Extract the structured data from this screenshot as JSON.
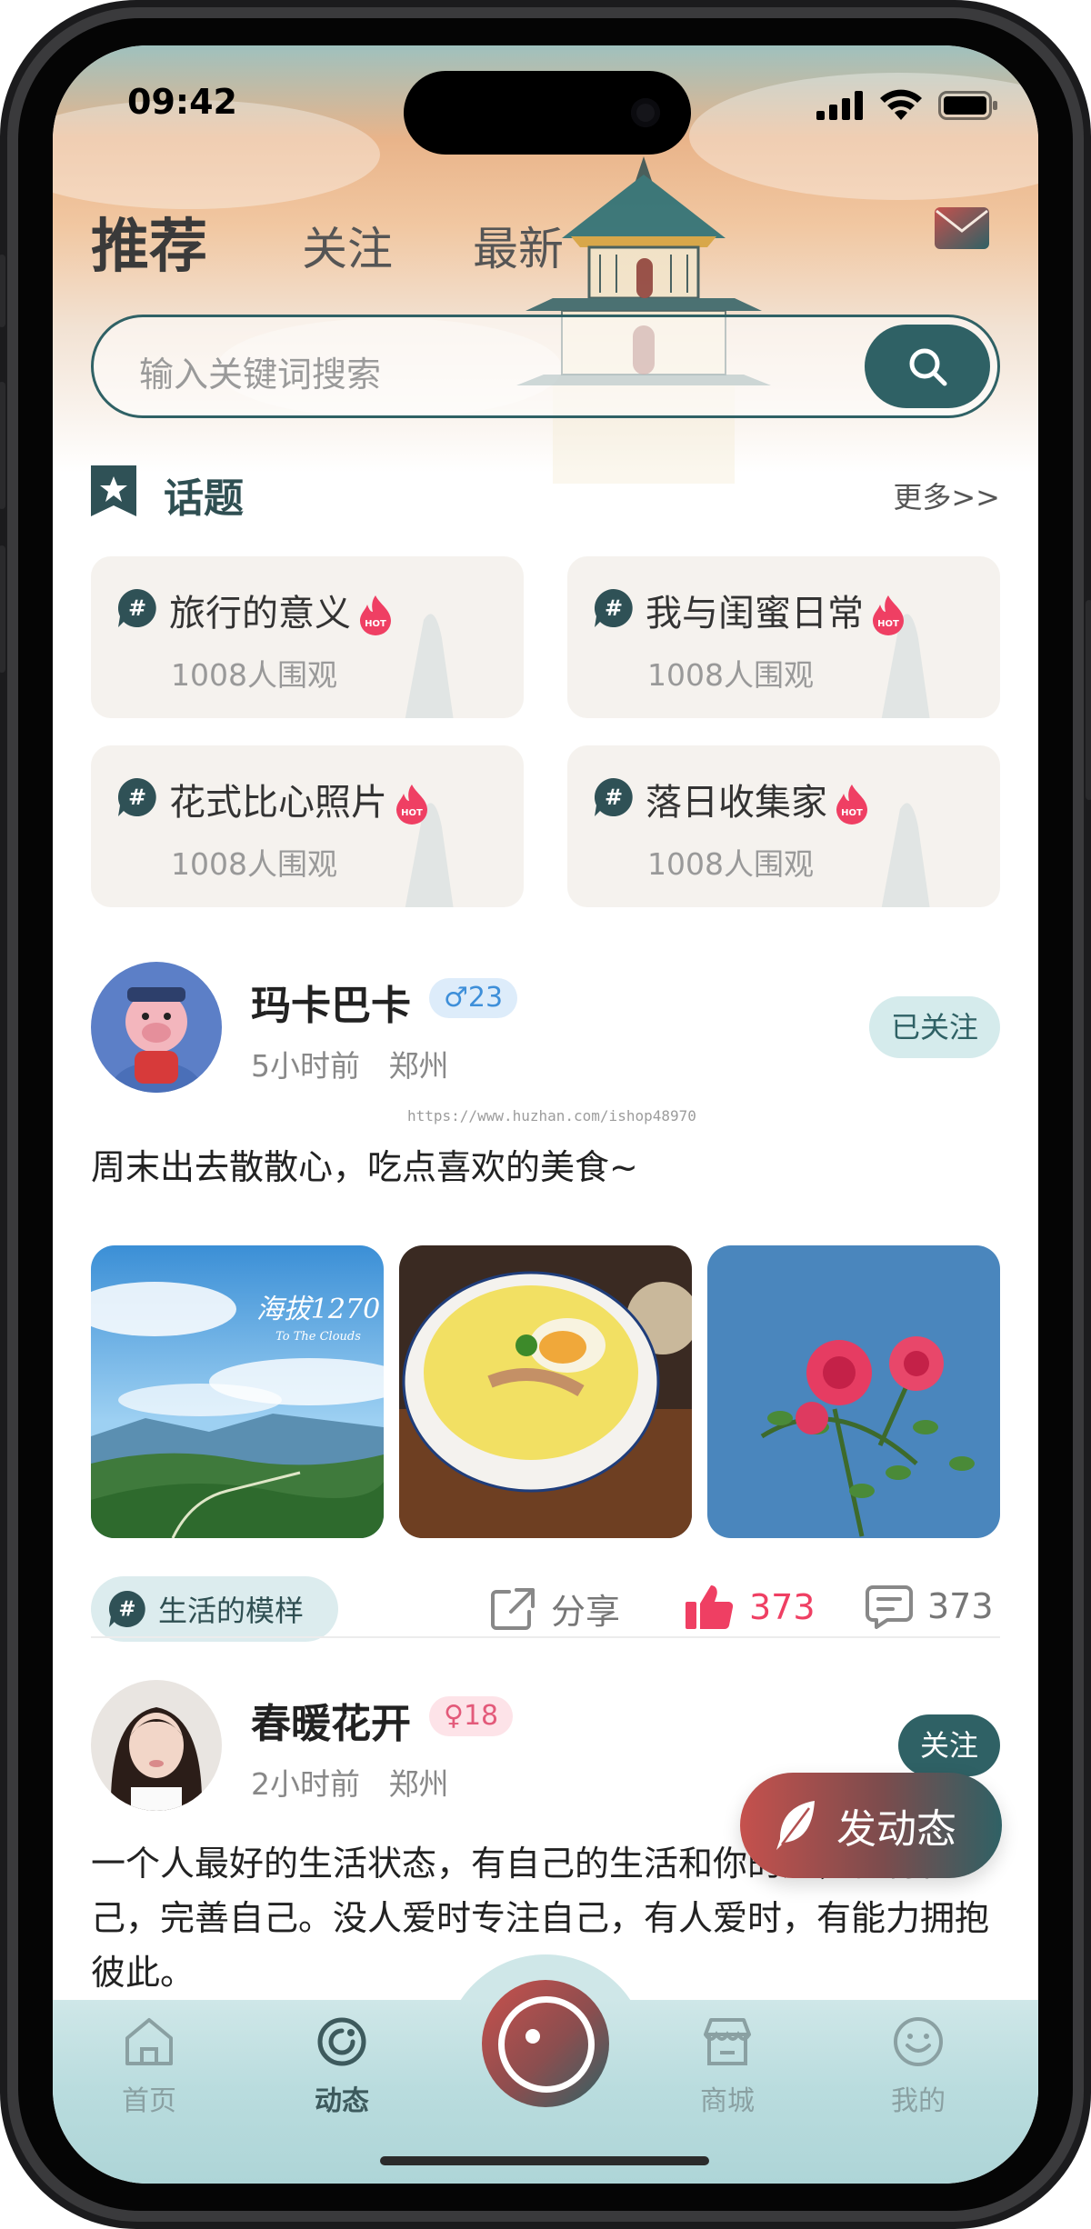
{
  "status": {
    "time": "09:42"
  },
  "tabs": {
    "recommend": "推荐",
    "follow": "关注",
    "latest": "最新"
  },
  "search": {
    "placeholder": "输入关键词搜索"
  },
  "topics_section": {
    "title": "话题",
    "more": "更多>>"
  },
  "topics": [
    {
      "title": "旅行的意义",
      "views": "1008人围观",
      "badge": "HOT"
    },
    {
      "title": "我与闺蜜日常",
      "views": "1008人围观",
      "badge": "HOT"
    },
    {
      "title": "花式比心照片",
      "views": "1008人围观",
      "badge": "HOT"
    },
    {
      "title": "落日收集家",
      "views": "1008人围观",
      "badge": "HOT"
    }
  ],
  "watermark": "https://www.huzhan.com/ishop48970",
  "posts": [
    {
      "username": "玛卡巴卡",
      "gender_age": "♂23",
      "time": "5小时前",
      "location": "郑州",
      "follow_label": "已关注",
      "content": "周末出去散散心，吃点喜欢的美食~",
      "photos": [
        {
          "overlay_title": "海拔1270",
          "overlay_sub": "To The Clouds"
        },
        {
          "overlay_title": "",
          "overlay_sub": ""
        },
        {
          "overlay_title": "",
          "overlay_sub": ""
        }
      ],
      "topic_chip": "生活的模样",
      "share_label": "分享",
      "likes": "373",
      "comments": "373"
    },
    {
      "username": "春暖花开",
      "gender_age": "♀18",
      "time": "2小时前",
      "location": "郑州",
      "follow_label": "关注",
      "content": "一个人最好的生活状态，有自己的生活和你的爱，善待自己，完善自己。没人爱时专注自己，有人爱时，有能力拥抱彼此。"
    }
  ],
  "fab": {
    "label": "发动态"
  },
  "tabbar": {
    "home": "首页",
    "feed": "动态",
    "shop": "商城",
    "mine": "我的"
  },
  "colors": {
    "primary": "#2f6165",
    "like": "#ef3f63",
    "accent_red": "#c5514d"
  }
}
